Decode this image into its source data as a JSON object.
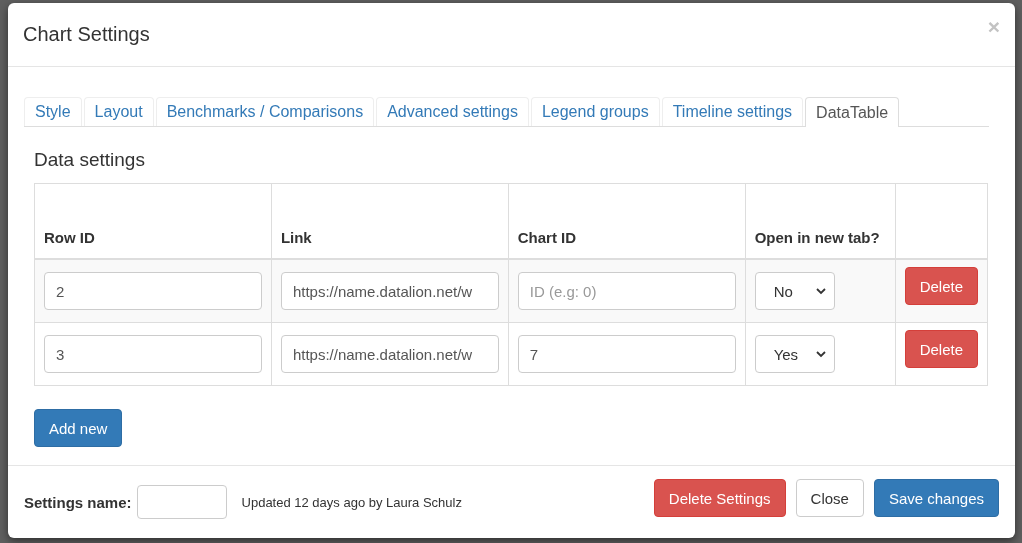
{
  "modal": {
    "title": "Chart Settings",
    "close": "×"
  },
  "tabs": [
    {
      "label": "Style",
      "selected": false
    },
    {
      "label": "Layout",
      "selected": false
    },
    {
      "label": "Benchmarks / Comparisons",
      "selected": false
    },
    {
      "label": "Advanced settings",
      "selected": false
    },
    {
      "label": "Legend groups",
      "selected": false
    },
    {
      "label": "Timeline settings",
      "selected": false
    },
    {
      "label": "DataTable",
      "selected": true
    }
  ],
  "section_title": "Data settings",
  "table": {
    "columns": [
      "Row ID",
      "Link",
      "Chart ID",
      "Open in new tab?"
    ],
    "rows": [
      {
        "row_id": "2",
        "link": "https://name.datalion.net/w",
        "chart_id": {
          "placeholder": "ID (e.g: 0)"
        },
        "open_in_new_tab": "No",
        "delete": "Delete"
      },
      {
        "row_id": "3",
        "link": "https://name.datalion.net/w",
        "chart_id": {
          "value": "7"
        },
        "open_in_new_tab": "Yes",
        "delete": "Delete"
      }
    ]
  },
  "add_button": "Add new",
  "footer": {
    "settings_name_label": "Settings name:",
    "updated": "Updated 12 days ago by Laura Schulz",
    "buttons": [
      {
        "label": "Delete Settings",
        "kind": "danger"
      },
      {
        "label": "Close",
        "kind": "default"
      },
      {
        "label": "Save changes",
        "kind": "primary"
      }
    ]
  }
}
